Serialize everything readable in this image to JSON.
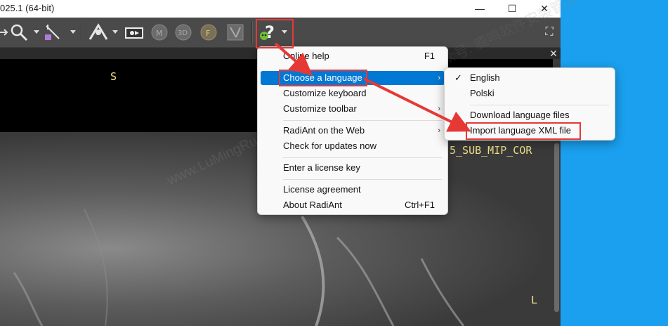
{
  "window": {
    "title": "025.1 (64-bit)",
    "controls": {
      "minimize": "—",
      "maximize": "☐",
      "close": "✕"
    }
  },
  "toolbar": {
    "icons": [
      "pan-zoom-icon",
      "magnify-icon",
      "measure-icon",
      "mip-icon",
      "cine-icon",
      "mpr-icon",
      "3d-icon",
      "fusion-icon",
      "windowing-icon",
      "help-icon"
    ],
    "fullscreen": "⛶"
  },
  "viewer": {
    "orientation_top": "S",
    "orientation_right": "L",
    "series_label": "5_SUB_MIP_COR",
    "close": "✕"
  },
  "help_menu": {
    "items": [
      {
        "label": "Online help",
        "accel": "F1",
        "arrow": ""
      },
      {
        "label": "Choose a language",
        "accel": "",
        "arrow": "›"
      },
      {
        "label": "Customize keyboard",
        "accel": "",
        "arrow": ""
      },
      {
        "label": "Customize toolbar",
        "accel": "",
        "arrow": "›"
      },
      {
        "label": "RadiAnt on the Web",
        "accel": "",
        "arrow": "›"
      },
      {
        "label": "Check for updates now",
        "accel": "",
        "arrow": ""
      },
      {
        "label": "Enter a license key",
        "accel": "",
        "arrow": ""
      },
      {
        "label": "License agreement",
        "accel": "",
        "arrow": ""
      },
      {
        "label": "About RadiAnt",
        "accel": "Ctrl+F1",
        "arrow": ""
      }
    ]
  },
  "language_menu": {
    "items": [
      {
        "label": "English",
        "check": "✓"
      },
      {
        "label": "Polski",
        "check": ""
      },
      {
        "label": "Download language files",
        "check": ""
      },
      {
        "label": "Import language XML file",
        "check": ""
      }
    ]
  },
  "watermarks": [
    "www.LuMingRuan.com",
    "公众号: 鹿鸣软件安装管家"
  ],
  "colors": {
    "desktop": "#1aa0ef",
    "highlight": "#0078d4",
    "annotation_red": "#e53935",
    "overlay_text": "#f2e28a"
  }
}
